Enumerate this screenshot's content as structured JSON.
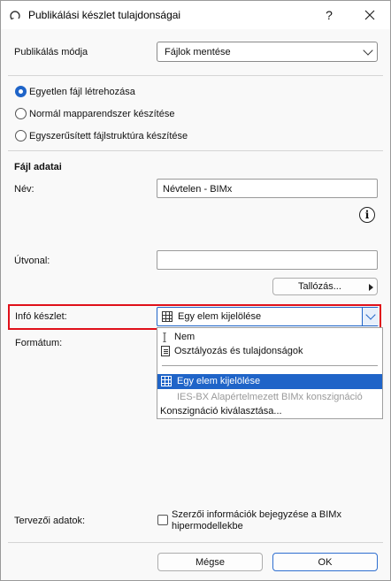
{
  "window": {
    "title": "Publikálási készlet tulajdonságai",
    "help_label": "?",
    "close_label": "✕"
  },
  "publish_mode": {
    "label": "Publikálás módja",
    "value": "Fájlok mentése"
  },
  "file_options": [
    {
      "label": "Egyetlen fájl létrehozása",
      "checked": true
    },
    {
      "label": "Normál mapparendszer készítése",
      "checked": false
    },
    {
      "label": "Egyszerűsített fájlstruktúra készítése",
      "checked": false
    }
  ],
  "file_data": {
    "heading": "Fájl adatai",
    "name_label": "Név:",
    "name_value": "Névtelen - BIMx",
    "info_glyph": "i",
    "path_label": "Útvonal:",
    "path_value": "",
    "browse_label": "Tallózás..."
  },
  "info_set": {
    "label": "Infó készlet:",
    "value": "Egy elem kijelölése"
  },
  "format": {
    "label": "Formátum:"
  },
  "popup": {
    "items": [
      {
        "label": "Nem",
        "icon": "text-cursor-icon",
        "state": "normal"
      },
      {
        "label": "Osztályozás és tulajdonságok",
        "icon": "document-icon",
        "state": "normal"
      },
      {
        "label": "Egy elem kijelölése",
        "icon": "grid-icon",
        "state": "selected"
      },
      {
        "label": "IES-BX Alapértelmezett BIMx konszignáció",
        "icon": "",
        "state": "disabled"
      },
      {
        "label": "Konszignáció kiválasztása...",
        "icon": "",
        "state": "normal"
      }
    ]
  },
  "designer_data": {
    "label": "Tervezői adatok:",
    "checkbox_label_line1": "Szerzői információk bejegyzése a BIMx",
    "checkbox_label_line2": "hipermodellekbe",
    "checked": false
  },
  "footer": {
    "cancel_label": "Mégse",
    "ok_label": "OK"
  },
  "colors": {
    "accent": "#1f64c8",
    "highlight": "#e0101a"
  }
}
